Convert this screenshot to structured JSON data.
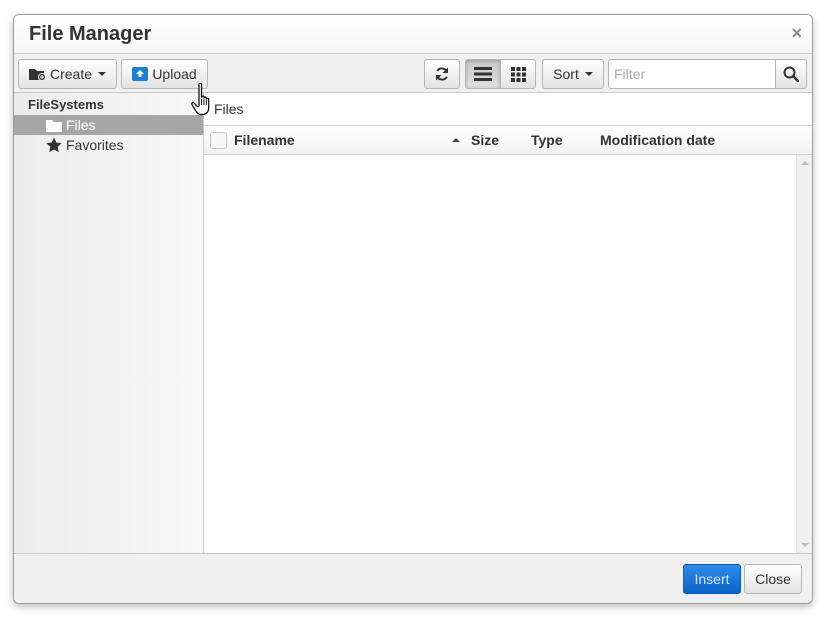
{
  "dialog": {
    "title": "File Manager",
    "close_symbol": "×"
  },
  "toolbar": {
    "create_label": "Create",
    "upload_label": "Upload",
    "refresh_icon": "refresh-icon",
    "list_view_icon": "list-view-icon",
    "grid_view_icon": "grid-view-icon",
    "sort_label": "Sort",
    "filter": {
      "placeholder": "Filter",
      "value": ""
    },
    "search_icon": "search-icon"
  },
  "sidebar": {
    "root_label": "FileSystems",
    "items": [
      {
        "label": "Files",
        "icon": "folder-icon",
        "selected": true
      },
      {
        "label": "Favorites",
        "icon": "star-icon",
        "selected": false
      }
    ]
  },
  "main": {
    "breadcrumb": "Files",
    "columns": [
      {
        "label": "Filename",
        "sorted": "asc"
      },
      {
        "label": "Size"
      },
      {
        "label": "Type"
      },
      {
        "label": "Modification date"
      }
    ],
    "rows": []
  },
  "footer": {
    "insert_label": "Insert",
    "close_label": "Close"
  },
  "colors": {
    "primary": "#0a63c9",
    "selected_row": "#a6a6a6"
  }
}
